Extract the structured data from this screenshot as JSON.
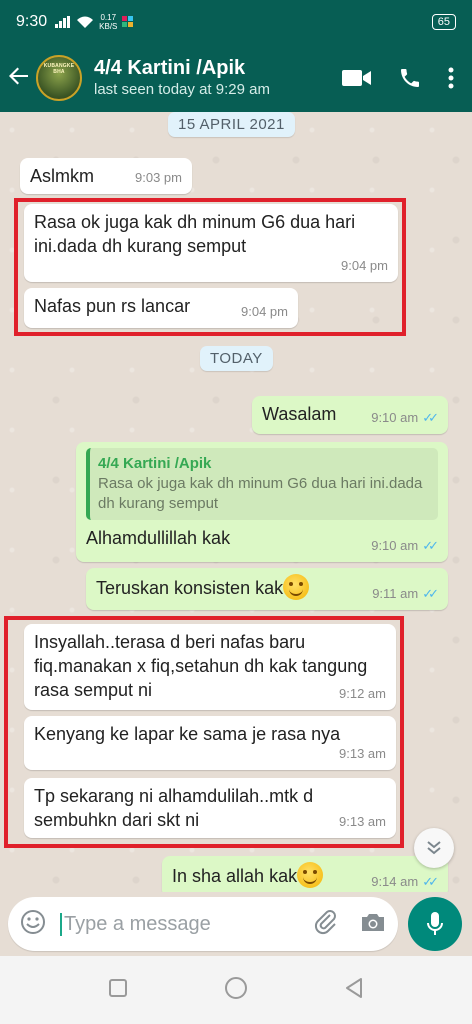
{
  "status_bar": {
    "time": "9:30",
    "net_speed_value": "0.17",
    "net_speed_unit": "KB/S",
    "battery": "65"
  },
  "header": {
    "contact_name": "4/4 Kartini /Apik",
    "last_seen": "last seen today at 9:29 am",
    "avatar_text": "KUBANGKE BHA"
  },
  "dates": {
    "first": "15 APRIL 2021",
    "second": "TODAY"
  },
  "messages": [
    {
      "text": "Aslmkm",
      "time": "9:03 pm"
    },
    {
      "text": "Rasa ok juga kak dh minum G6 dua hari ini.dada dh kurang semput",
      "time": "9:04 pm"
    },
    {
      "text": "Nafas pun rs lancar",
      "time": "9:04 pm"
    },
    {
      "text": "Wasalam",
      "time": "9:10 am"
    },
    {
      "quote_name": "4/4 Kartini /Apik",
      "quote_text": "Rasa ok juga kak dh minum G6 dua hari ini.dada dh kurang semput",
      "text": "Alhamdullillah kak",
      "time": "9:10 am"
    },
    {
      "text": "Teruskan konsisten kak",
      "time": "9:11 am"
    },
    {
      "text": "Insyallah..terasa d beri nafas baru fiq.manakan x fiq,setahun dh kak tangung rasa semput ni",
      "time": "9:12 am"
    },
    {
      "text": "Kenyang ke lapar ke sama je rasa nya",
      "time": "9:13 am"
    },
    {
      "text": "Tp sekarang ni alhamdulilah..mtk d sembuhkn dari skt ni",
      "time": "9:13 am"
    },
    {
      "text": "In sha allah kak",
      "time": "9:14 am"
    }
  ],
  "input": {
    "placeholder": "Type a message"
  },
  "colors": {
    "header": "#075e54",
    "outgoing_bubble": "#dcf8c6",
    "incoming_bubble": "#ffffff",
    "highlight": "#e0202b",
    "read_ticks": "#4fb6ec",
    "mic_button": "#00897b"
  }
}
